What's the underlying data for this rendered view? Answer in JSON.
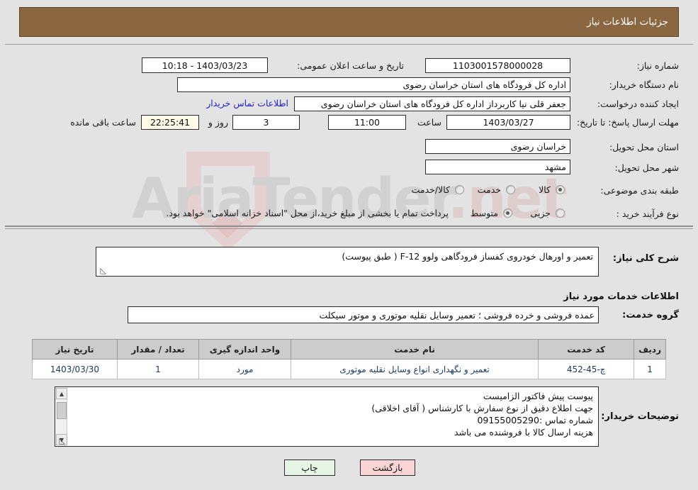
{
  "header": {
    "title": "جزئیات اطلاعات نیاز"
  },
  "form": {
    "need_number_label": "شماره نیاز:",
    "need_number_value": "1103001578000028",
    "buyer_org_label": "نام دستگاه خریدار:",
    "buyer_org_value": "اداره کل فرودگاه های استان خراسان رضوی",
    "creator_label": "ایجاد کننده درخواست:",
    "creator_value": "جعفر قلی نیا کاربرداز اداره کل فرودگاه های استان خراسان رضوی",
    "contact_link": "اطلاعات تماس خریدار",
    "deadline_label": "مهلت ارسال پاسخ: تا تاریخ:",
    "deadline_date": "1403/03/27",
    "hour_label": "ساعت",
    "deadline_time": "11:00",
    "days_value": "3",
    "days_label": "روز و",
    "countdown_value": "22:25:41",
    "remaining_label": "ساعت باقی مانده",
    "announce_label": "تاریخ و ساعت اعلان عمومی:",
    "announce_value": "1403/03/23 - 10:18",
    "province_label": "استان محل تحویل:",
    "province_value": "خراسان رضوی",
    "city_label": "شهر محل تحویل:",
    "city_value": "مشهد",
    "category_label": "طبقه بندی موضوعی:",
    "category_options": [
      {
        "label": "کالا",
        "selected": false
      },
      {
        "label": "خدمت",
        "selected": true
      },
      {
        "label": "کالا/خدمت",
        "selected": false
      }
    ],
    "process_label": "نوع فرآیند خرید :",
    "process_options": [
      {
        "label": "جزیی",
        "selected": false
      },
      {
        "label": "متوسط",
        "selected": true
      }
    ],
    "process_note": "پرداخت تمام یا بخشی از مبلغ خرید،از محل \"اسناد خزانه اسلامی\" خواهد بود."
  },
  "description": {
    "label": "شرح کلی نیاز:",
    "value": "تعمیر و اورهال خودروی کفساز فرودگاهی ولوو  F-12 ( طبق پیوست)"
  },
  "services_section": {
    "heading": "اطلاعات خدمات مورد نیاز",
    "group_label": "گروه خدمت:",
    "group_value": "عمده فروشی و خرده فروشی ؛ تعمیر وسایل نقلیه موتوری و موتور سیکلت"
  },
  "table": {
    "columns": [
      "ردیف",
      "کد خدمت",
      "نام خدمت",
      "واحد اندازه گیری",
      "تعداد / مقدار",
      "تاریخ نیاز"
    ],
    "rows": [
      {
        "row_no": "1",
        "service_code": "چ-45-452",
        "service_name": "تعمیر و نگهداری انواع وسایل نقلیه موتوری",
        "unit": "مورد",
        "quantity": "1",
        "need_date": "1403/03/30"
      }
    ]
  },
  "buyer_notes": {
    "label": "توضیحات خریدار:",
    "lines": [
      "پیوست پیش فاکتور الزامیست",
      "جهت اطلاع دقیق از نوع سفارش با کارشناس  ( آقای اخلاقی)",
      "شماره تماس :09155005290",
      "هزینه ارسال کالا با فروشنده می باشد"
    ]
  },
  "footer": {
    "print_label": "چاپ",
    "back_label": "بازگشت"
  },
  "watermark": {
    "text_main": "AriaTender",
    "text_suffix": ".net"
  }
}
